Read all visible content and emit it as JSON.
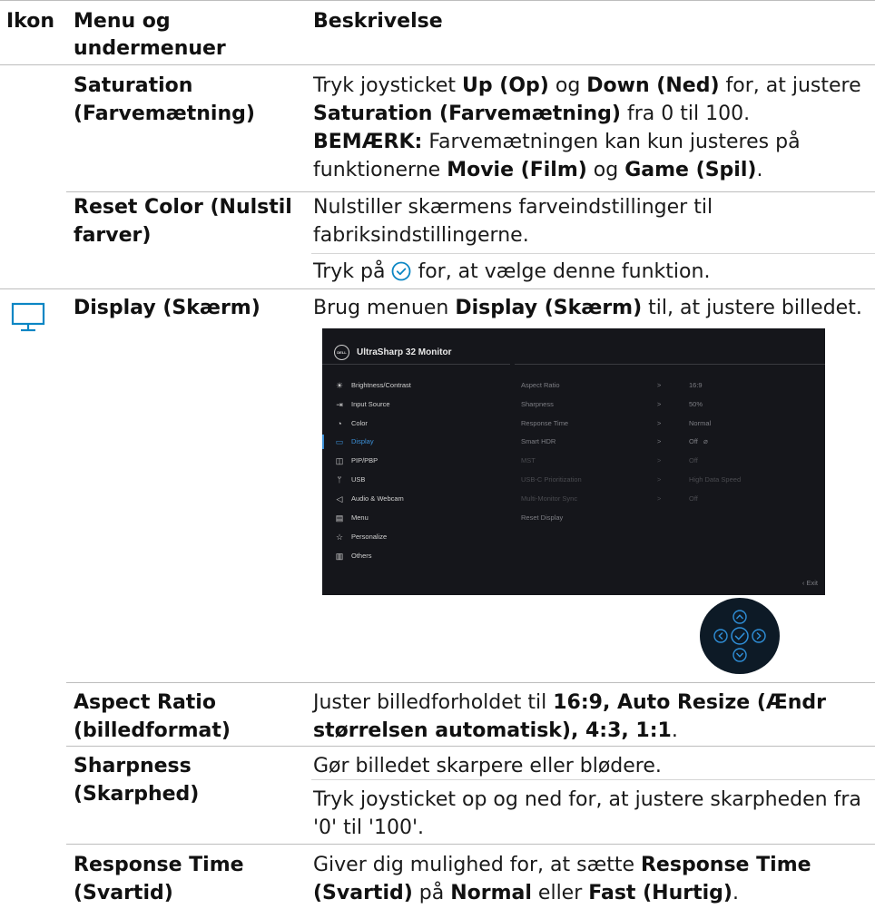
{
  "header": {
    "col_icon": "Ikon",
    "col_menu_1": "Menu og",
    "col_menu_2": "undermenuer",
    "col_desc": "Beskrivelse"
  },
  "saturation": {
    "menu_1": "Saturation",
    "menu_2": "(Farvemætning)",
    "l1a": "Tryk joysticket ",
    "l1b": "Up (Op)",
    "l1c": " og ",
    "l1d": "Down (Ned)",
    "l1e": " for, at justere",
    "l2a": "Saturation (Farvemætning)",
    "l2b": " fra 0 til 100.",
    "l3a": "BEMÆRK:",
    "l3b": " Farvemætningen kan kun justeres på",
    "l4a": "funktionerne ",
    "l4b": "Movie (Film)",
    "l4c": " og ",
    "l4d": "Game (Spil)",
    "l4e": "."
  },
  "reset_color": {
    "menu_1": "Reset Color (Nulstil",
    "menu_2": "farver)",
    "l1": "Nulstiller skærmens farveindstillinger til",
    "l2": "fabriksindstillingerne.",
    "l3a": "Tryk på ",
    "l3b": " for, at vælge denne funktion."
  },
  "display": {
    "menu": "Display (Skærm)",
    "l1a": "Brug menuen ",
    "l1b": "Display (Skærm)",
    "l1c": " til, at justere billedet."
  },
  "osd": {
    "logo": "DELL",
    "title": "UltraSharp 32 Monitor",
    "menu_items": [
      {
        "icon": "☀",
        "label": "Brightness/Contrast"
      },
      {
        "icon": "⇥",
        "label": "Input Source"
      },
      {
        "icon": "◔",
        "label": "Color"
      },
      {
        "icon": "▭",
        "label": "Display"
      },
      {
        "icon": "◫",
        "label": "PIP/PBP"
      },
      {
        "icon": "ᛘ",
        "label": "USB"
      },
      {
        "icon": "◁",
        "label": "Audio & Webcam"
      },
      {
        "icon": "▤",
        "label": "Menu"
      },
      {
        "icon": "☆",
        "label": "Personalize"
      },
      {
        "icon": "▥",
        "label": "Others"
      }
    ],
    "settings": [
      {
        "key": "Aspect Ratio",
        "arrow": ">",
        "value": "16:9"
      },
      {
        "key": "Sharpness",
        "arrow": ">",
        "value": "50%"
      },
      {
        "key": "Response Time",
        "arrow": ">",
        "value": "Normal"
      },
      {
        "key": "Smart HDR",
        "arrow": ">",
        "value": "Off"
      },
      {
        "key": "MST",
        "arrow": ">",
        "value": "Off"
      },
      {
        "key": "USB-C Prioritization",
        "arrow": ">",
        "value": "High Data Speed"
      },
      {
        "key": "Multi-Monitor Sync",
        "arrow": ">",
        "value": "Off"
      },
      {
        "key": "Reset Display",
        "arrow": "",
        "value": ""
      }
    ],
    "exit": "‹  Exit"
  },
  "aspect_ratio": {
    "menu_1": "Aspect Ratio",
    "menu_2": "(billedformat)",
    "l1a": "Juster billedforholdet til ",
    "l1b": "16:9, Auto Resize (Ændr",
    "l2a": "størrelsen automatisk), 4:3, 1:1",
    "l2b": "."
  },
  "sharpness": {
    "menu_1": "Sharpness",
    "menu_2": "(Skarphed)",
    "l1": "Gør billedet skarpere eller blødere.",
    "l2": "Tryk joysticket op og ned for, at justere skarpheden fra",
    "l3": "'0' til '100'."
  },
  "response_time": {
    "menu_1": "Response Time",
    "menu_2": "(Svartid)",
    "l1a": "Giver dig mulighed for, at sætte ",
    "l1b": "Response Time",
    "l2a": "(Svartid)",
    "l2b": " på ",
    "l2c": "Normal",
    "l2d": " eller ",
    "l2e": "Fast (Hurtig)",
    "l2f": "."
  },
  "colors": {
    "accent": "#0b86c4",
    "osd_bg": "#15161b",
    "osd_active": "#3b8fd6",
    "rule": "#bdbdbd"
  }
}
